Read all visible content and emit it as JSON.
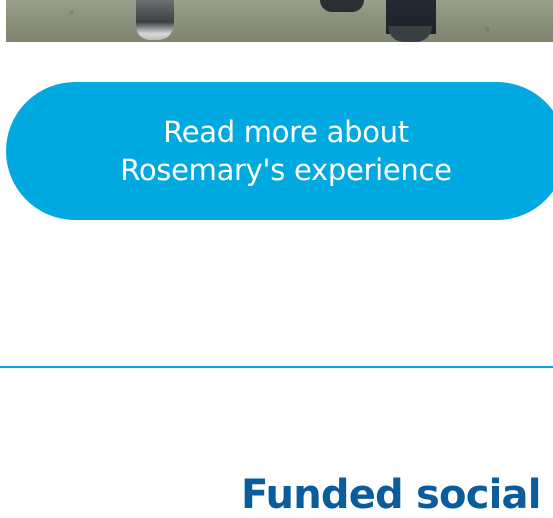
{
  "cta": {
    "line1": "Read more about",
    "line2": "Rosemary's experience"
  },
  "section": {
    "heading": "Funded social r"
  },
  "colors": {
    "accent": "#00a9df",
    "heading": "#0a5c9a",
    "background": "#ffffff"
  }
}
